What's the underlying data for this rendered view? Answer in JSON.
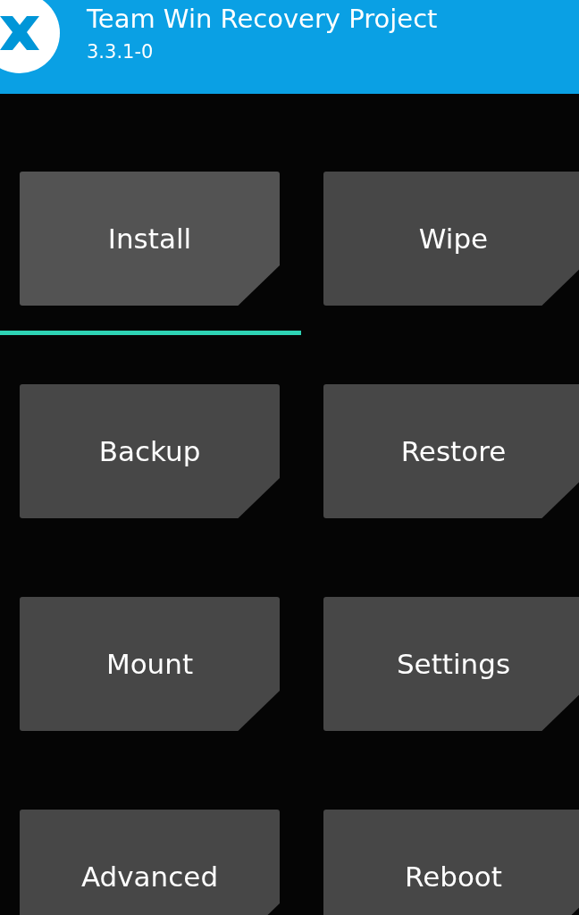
{
  "header": {
    "title": "Team Win Recovery Project",
    "version": "3.3.1-0"
  },
  "buttons": [
    {
      "label": "Install",
      "selected": true
    },
    {
      "label": "Wipe",
      "selected": false
    },
    {
      "label": "Backup",
      "selected": false
    },
    {
      "label": "Restore",
      "selected": false
    },
    {
      "label": "Mount",
      "selected": false
    },
    {
      "label": "Settings",
      "selected": false
    },
    {
      "label": "Advanced",
      "selected": false
    },
    {
      "label": "Reboot",
      "selected": false
    }
  ]
}
